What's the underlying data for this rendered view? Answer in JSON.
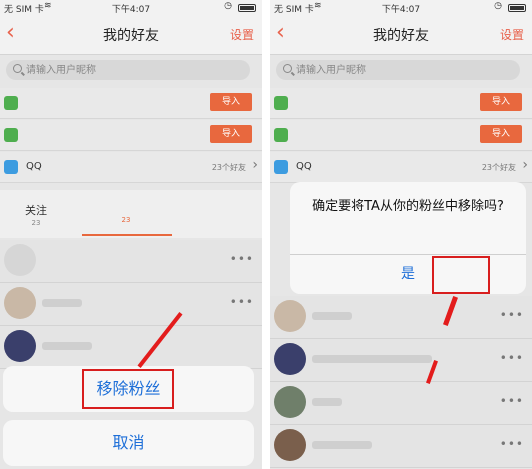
{
  "status_bar": {
    "carrier": "无 SIM 卡",
    "time": "下午4:07"
  },
  "nav": {
    "title": "我的好友",
    "settings_label": "设置"
  },
  "search": {
    "placeholder": "请输入用户昵称"
  },
  "rows": {
    "import_label": "导入",
    "qq_label": "QQ",
    "qq_count": "23个好友"
  },
  "tabs": {
    "follow_label": "关注",
    "follow_count": "23",
    "fans_count": "23"
  },
  "left_sheet": {
    "remove_label": "移除粉丝",
    "cancel_label": "取消"
  },
  "right_dialog": {
    "message": "确定要将TA从你的粉丝中移除吗?",
    "confirm_label": "是"
  },
  "colors": {
    "accent": "#e8683e",
    "link_blue": "#1e6fd8",
    "highlight_red": "#d81e1e"
  }
}
